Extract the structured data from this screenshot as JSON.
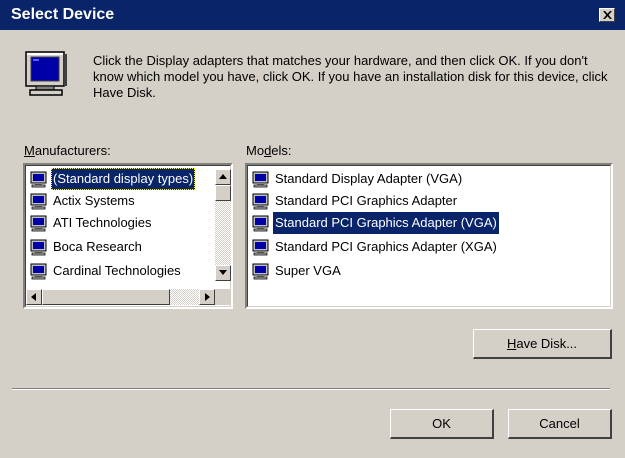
{
  "window": {
    "title": "Select Device",
    "close_glyph": "×"
  },
  "instructions": "Click the Display adapters that matches your hardware, and then click OK. If you don't know which model you have, click OK. If you have an installation disk for this device, click Have Disk.",
  "manufacturers": {
    "label_mnemonic": "M",
    "label_rest": "anufacturers:",
    "items": [
      {
        "label": "(Standard display types)",
        "selected": true
      },
      {
        "label": "Actix Systems",
        "selected": false
      },
      {
        "label": "ATI Technologies",
        "selected": false
      },
      {
        "label": "Boca Research",
        "selected": false
      },
      {
        "label": "Cardinal Technologies",
        "selected": false
      }
    ]
  },
  "models": {
    "label_pre": "Mo",
    "label_mnemonic": "d",
    "label_rest": "els:",
    "items": [
      {
        "label": "Standard Display Adapter (VGA)",
        "selected": false
      },
      {
        "label": "Standard PCI Graphics Adapter",
        "selected": false
      },
      {
        "label": "Standard PCI Graphics Adapter (VGA)",
        "selected": true
      },
      {
        "label": "Standard PCI Graphics Adapter (XGA)",
        "selected": false
      },
      {
        "label": "Super VGA",
        "selected": false
      }
    ]
  },
  "buttons": {
    "have_disk_mnemonic": "H",
    "have_disk_rest": "ave Disk...",
    "ok": "OK",
    "cancel": "Cancel"
  },
  "icons": {
    "dialog_icon": "monitor-icon",
    "list_item_icon": "display-adapter-icon"
  },
  "colors": {
    "title_bar": "#0a246a",
    "selection": "#0a246a",
    "face": "#d4d0c8"
  }
}
